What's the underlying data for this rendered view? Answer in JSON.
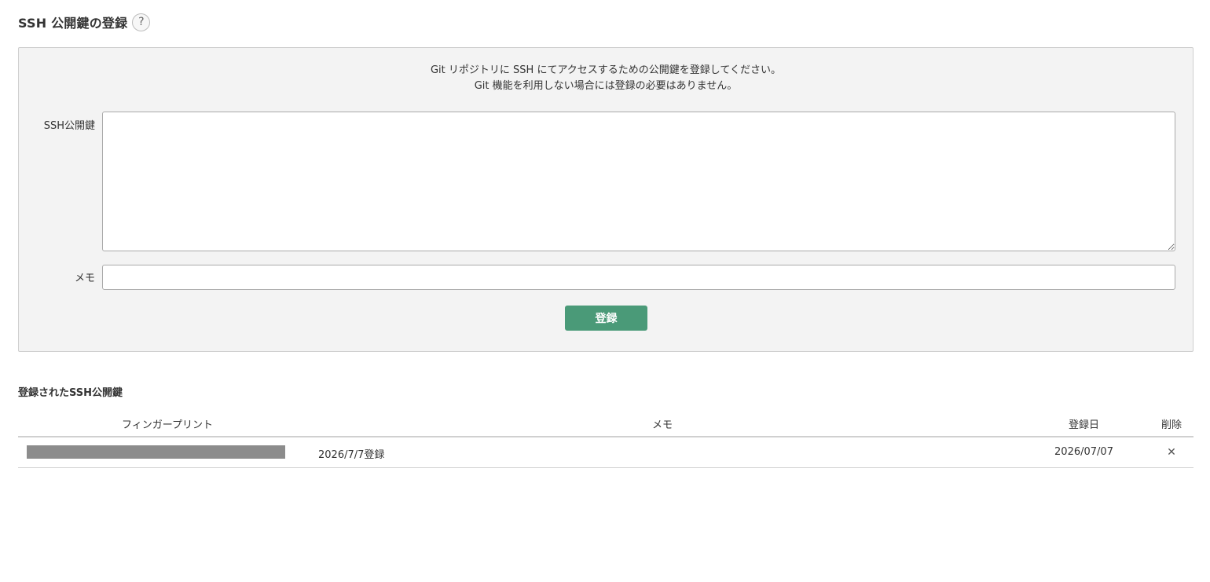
{
  "header": {
    "title": "SSH 公開鍵の登録",
    "help_icon": "question-mark-icon",
    "help_glyph": "?"
  },
  "form": {
    "intro_line1": "Git リポジトリに SSH にてアクセスするための公開鍵を登録してください。",
    "intro_line2": "Git 機能を利用しない場合には登録の必要はありません。",
    "key_label": "SSH公開鍵",
    "key_value": "",
    "memo_label": "メモ",
    "memo_value": "",
    "submit_label": "登録",
    "submit_color": "#4a9a78"
  },
  "registered": {
    "title": "登録されたSSH公開鍵",
    "columns": {
      "fingerprint": "フィンガープリント",
      "memo": "メモ",
      "date": "登録日",
      "delete": "削除"
    },
    "rows": [
      {
        "fingerprint_redacted": true,
        "memo": "2026/7/7登録",
        "date": "2026/07/07",
        "delete_icon": "close-icon",
        "delete_glyph": "✕"
      }
    ]
  }
}
